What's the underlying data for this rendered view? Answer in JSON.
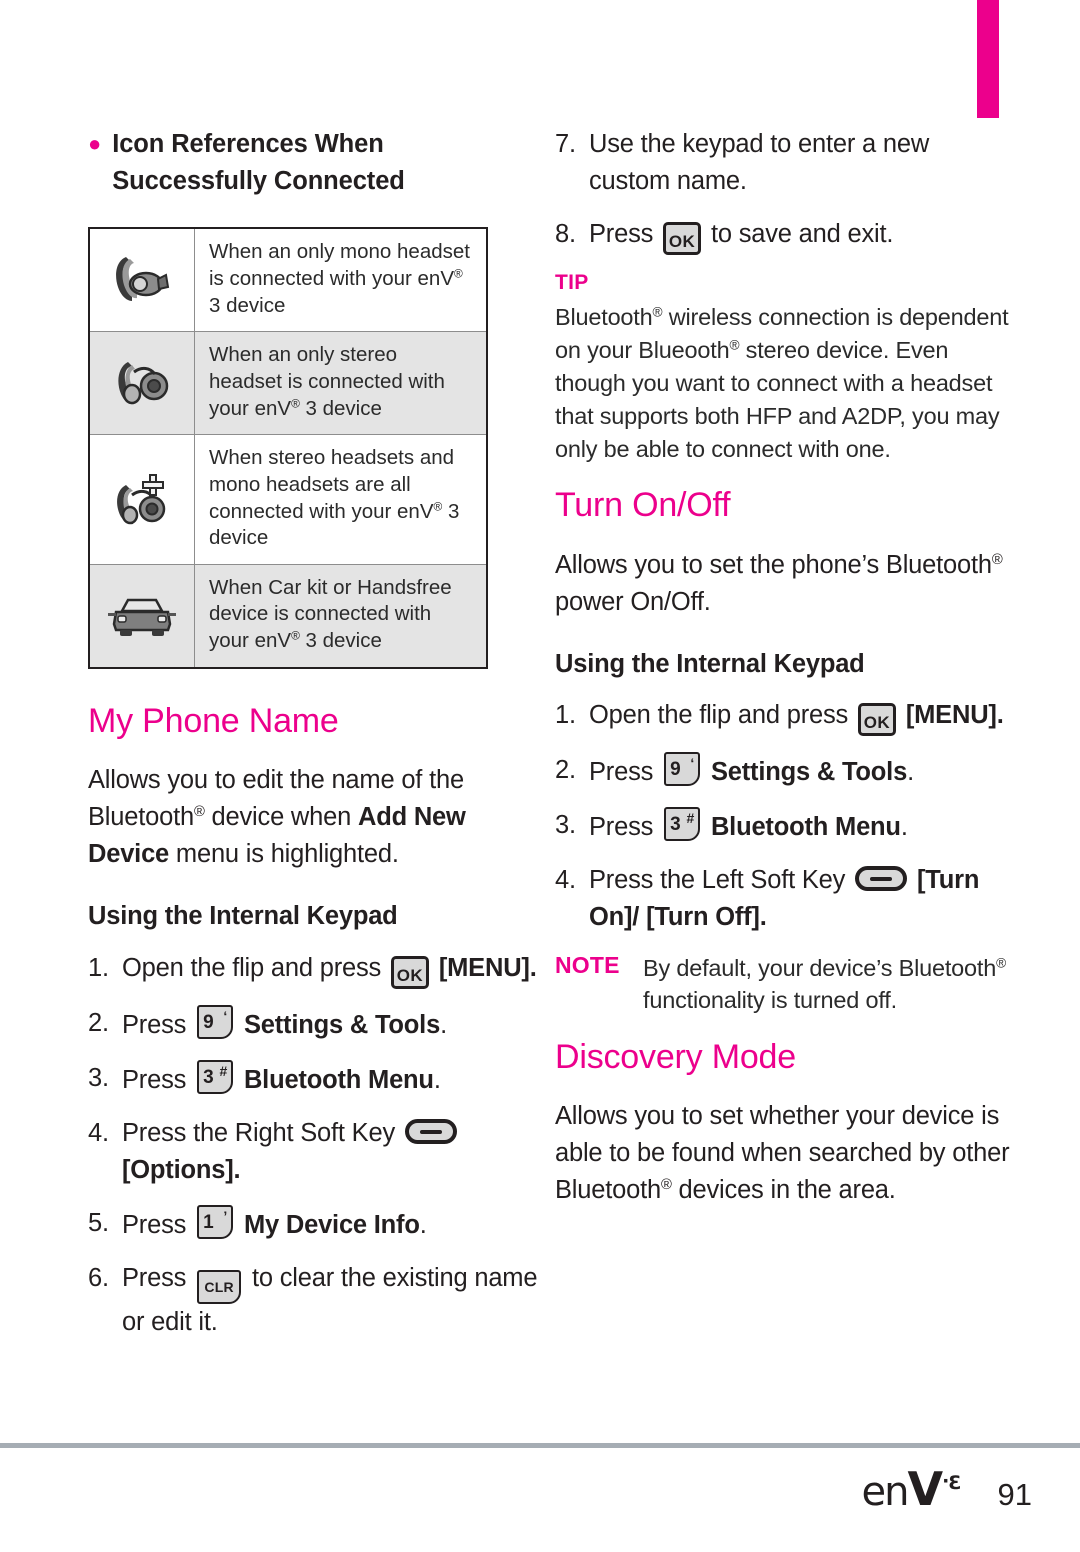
{
  "page": {
    "number": "91",
    "logo": {
      "text_en": "en",
      "text_v": "V",
      "sup_mark": "·",
      "sup_num": "3"
    }
  },
  "left_column": {
    "bullet_heading": "Icon References When Successfully Connected",
    "icon_table": {
      "rows": [
        {
          "icon": "mono-headset-icon",
          "shaded": false,
          "text_before_reg": "When an only mono headset is connected with your enV",
          "reg": "®",
          "text_after_reg": " 3 device"
        },
        {
          "icon": "stereo-headset-icon",
          "shaded": true,
          "text_before_reg": "When an only stereo headset is connected with your enV",
          "reg": "®",
          "text_after_reg": " 3 device"
        },
        {
          "icon": "stereo-plus-mono-headset-icon",
          "shaded": false,
          "text_before_reg": "When stereo headsets and mono headsets are all connected with your enV",
          "reg": "®",
          "text_after_reg": " 3 device"
        },
        {
          "icon": "car-kit-icon",
          "shaded": true,
          "text_before_reg": "When Car kit or Handsfree device is connected with your enV",
          "reg": "®",
          "text_after_reg": " 3 device"
        }
      ]
    },
    "section_title": "My Phone Name",
    "description_part1": "Allows you to edit the name of the Bluetooth",
    "description_reg": "®",
    "description_part2": " device when ",
    "description_bold1": "Add New Device",
    "description_part3": " menu is highlighted.",
    "subheading": "Using the Internal Keypad",
    "steps": [
      {
        "num": "1.",
        "text_pre": "Open the flip and press ",
        "key": "OK",
        "text_post": "",
        "bold_post": "[MENU]."
      },
      {
        "num": "2.",
        "text_pre": "Press ",
        "key_num": "9",
        "key_sup": "‘",
        "bold_post": "Settings & Tools",
        "text_end": "."
      },
      {
        "num": "3.",
        "text_pre": "Press ",
        "key_num": "3",
        "key_sup": "#",
        "bold_post": "Bluetooth Menu",
        "text_end": "."
      },
      {
        "num": "4.",
        "text_pre": "Press the Right Soft Key ",
        "key": "softkey",
        "bold_post": "[Options]."
      },
      {
        "num": "5.",
        "text_pre": "Press ",
        "key_num": "1",
        "key_sup": "’",
        "bold_post": "My Device Info",
        "text_end": "."
      },
      {
        "num": "6.",
        "text_pre": "Press ",
        "key": "CLR",
        "text_post": " to clear the existing name or edit it."
      }
    ]
  },
  "right_column": {
    "steps_continued": [
      {
        "num": "7.",
        "text": "Use the keypad to enter a new custom name."
      },
      {
        "num": "8.",
        "text_pre": "Press ",
        "key": "OK",
        "text_post": " to save and exit."
      }
    ],
    "tip": {
      "label": "TIP",
      "text_part1": "Bluetooth",
      "reg1": "®",
      "text_part2": " wireless connection is dependent on your Blueooth",
      "reg2": "®",
      "text_part3": " stereo device. Even though you want to connect with a headset that supports both HFP and A2DP, you may only be able to connect with one."
    },
    "section_turn": {
      "title": "Turn On/Off",
      "description_part1": "Allows you to set the phone’s Bluetooth",
      "description_reg": "®",
      "description_part2": " power On/Off.",
      "subheading": "Using the Internal Keypad",
      "steps": [
        {
          "num": "1.",
          "text_pre": "Open the flip and press ",
          "key": "OK",
          "bold_post": "[MENU]."
        },
        {
          "num": "2.",
          "text_pre": "Press ",
          "key_num": "9",
          "key_sup": "‘",
          "bold_post": "Settings & Tools",
          "text_end": "."
        },
        {
          "num": "3.",
          "text_pre": "Press ",
          "key_num": "3",
          "key_sup": "#",
          "bold_post": "Bluetooth Menu",
          "text_end": "."
        },
        {
          "num": "4.",
          "text_pre": "Press the Left Soft Key ",
          "key": "softkey",
          "bold_post": "[Turn On]/ [Turn Off]."
        }
      ],
      "note": {
        "label": "NOTE",
        "text_part1": "By default, your device’s Bluetooth",
        "reg": "®",
        "text_part2": " functionality is turned off."
      }
    },
    "section_discovery": {
      "title": "Discovery Mode",
      "description_part1": "Allows you to set whether your device is able to be found when searched by other Bluetooth",
      "reg": "®",
      "description_part2": " devices in the area."
    }
  },
  "colors": {
    "accent_pink": "#ec008c",
    "text": "#231f20",
    "table_shade": "#e4e4e4",
    "rule_gray": "#a6adb4"
  }
}
